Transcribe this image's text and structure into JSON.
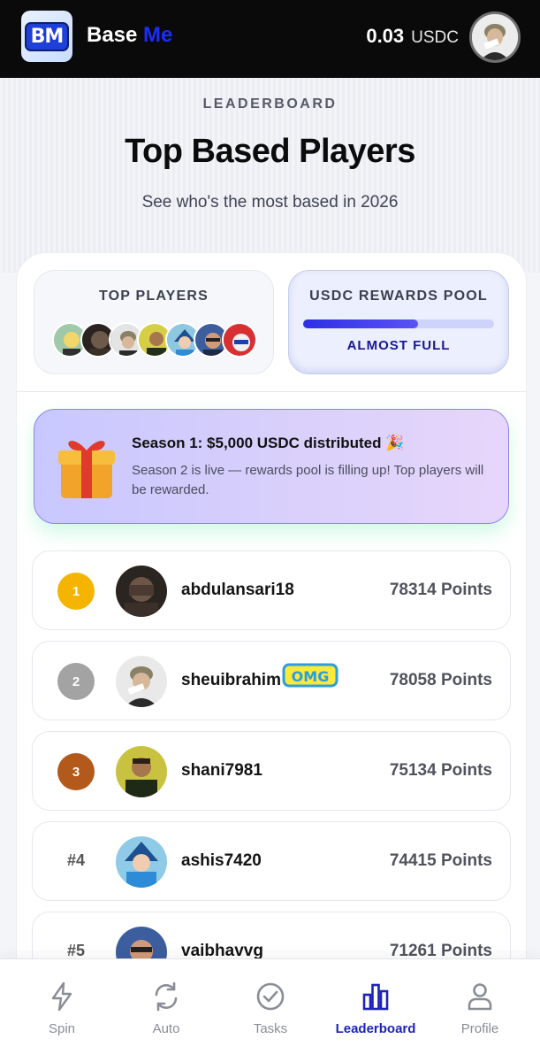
{
  "header": {
    "logo_text": "BM",
    "brand_first": "Base",
    "brand_second": "Me",
    "balance_amount": "0.03",
    "balance_currency": "USDC"
  },
  "hero": {
    "eyebrow": "LEADERBOARD",
    "title": "Top Based Players",
    "subtitle": "See who's the most based in 2026"
  },
  "stats": {
    "top_players_label": "TOP PLAYERS",
    "pool_label": "USDC REWARDS POOL",
    "pool_fill_fraction": 0.6,
    "pool_status": "ALMOST FULL"
  },
  "season": {
    "title": "Season 1: $5,000 USDC distributed 🎉",
    "description": "Season 2 is live — rewards pool is filling up! Top players will be rewarded."
  },
  "leaderboard": [
    {
      "rank": "1",
      "name": "abdulansari18",
      "points": "78314 Points"
    },
    {
      "rank": "2",
      "name": "sheuibrahim",
      "points": "78058 Points",
      "badge": "OMG"
    },
    {
      "rank": "3",
      "name": "shani7981",
      "points": "75134 Points"
    },
    {
      "rank": "#4",
      "name": "ashis7420",
      "points": "74415 Points"
    },
    {
      "rank": "#5",
      "name": "vaibhavvg",
      "points": "71261 Points"
    }
  ],
  "nav": {
    "items": [
      {
        "label": "Spin",
        "icon": "lightning-icon"
      },
      {
        "label": "Auto",
        "icon": "refresh-icon"
      },
      {
        "label": "Tasks",
        "icon": "check-circle-icon"
      },
      {
        "label": "Leaderboard",
        "icon": "bar-chart-icon"
      },
      {
        "label": "Profile",
        "icon": "user-icon"
      }
    ],
    "active": "Leaderboard"
  },
  "colors": {
    "accent": "#1d23b8",
    "gold": "#f5b400",
    "silver": "#a3a3a3",
    "bronze": "#b2591b"
  }
}
